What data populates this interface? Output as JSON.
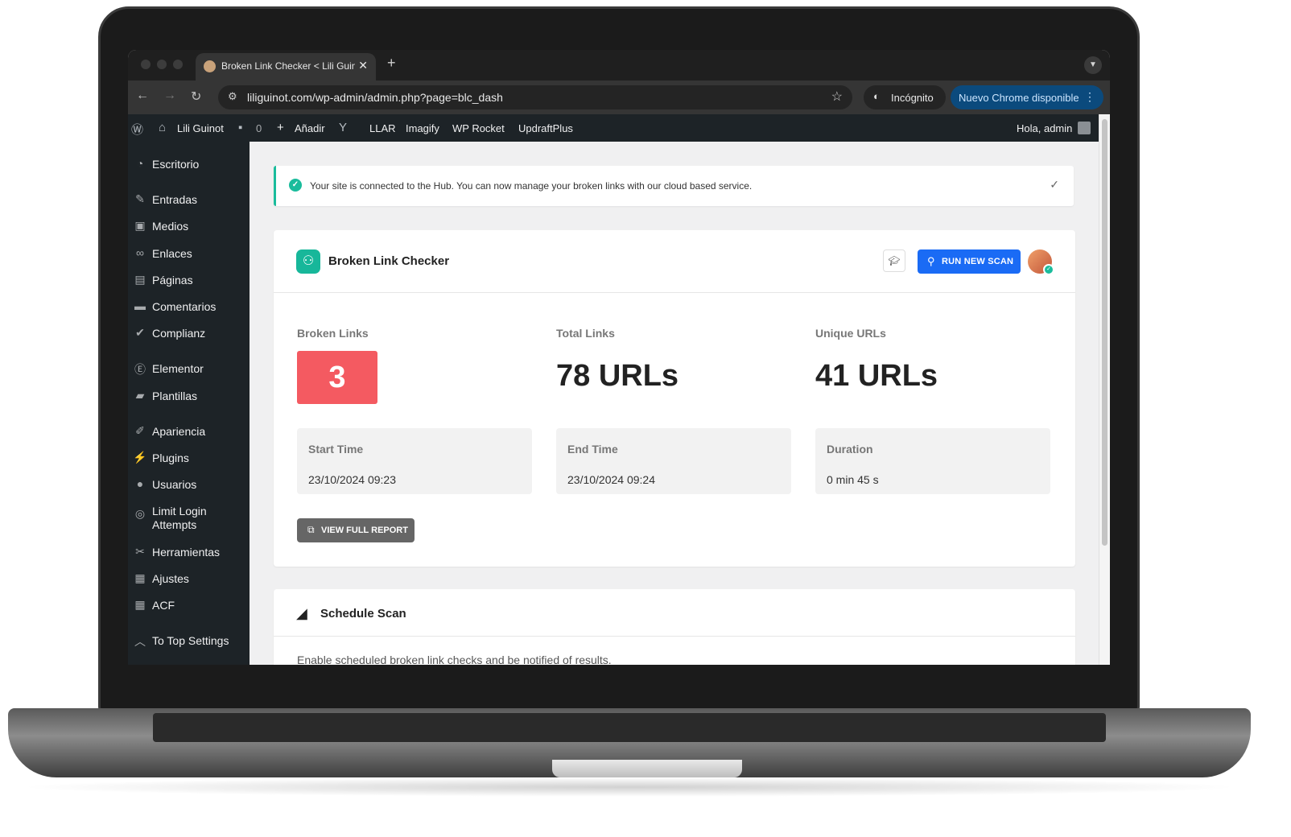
{
  "browser": {
    "tab_title": "Broken Link Checker < Lili Guinot",
    "tab_close_glyph": "✕",
    "new_tab_glyph": "+",
    "url": "liliguinot.com/wp-admin/admin.php?page=blc_dash",
    "incognito_label": "Incógnito",
    "update_label": "Nuevo Chrome disponible"
  },
  "admin_bar": {
    "site_name": "Lili Guinot",
    "comments_count": "0",
    "add_new": "Añadir",
    "items": [
      "LLAR",
      "Imagify",
      "WP Rocket",
      "UpdraftPlus"
    ],
    "greeting": "Hola, admin"
  },
  "sidebar": {
    "items": [
      {
        "label": "Escritorio",
        "icon": "dashboard-icon"
      },
      {
        "label": "Entradas",
        "icon": "pin-icon"
      },
      {
        "label": "Medios",
        "icon": "media-icon"
      },
      {
        "label": "Enlaces",
        "icon": "link-icon"
      },
      {
        "label": "Páginas",
        "icon": "pages-icon"
      },
      {
        "label": "Comentarios",
        "icon": "comment-icon"
      },
      {
        "label": "Complianz",
        "icon": "check-icon"
      },
      {
        "label": "Elementor",
        "icon": "elementor-icon"
      },
      {
        "label": "Plantillas",
        "icon": "folder-icon"
      },
      {
        "label": "Apariencia",
        "icon": "brush-icon"
      },
      {
        "label": "Plugins",
        "icon": "plug-icon"
      },
      {
        "label": "Usuarios",
        "icon": "user-icon"
      },
      {
        "label": "Limit Login Attempts",
        "icon": "fingerprint-icon"
      },
      {
        "label": "Herramientas",
        "icon": "wrench-icon"
      },
      {
        "label": "Ajustes",
        "icon": "sliders-icon"
      },
      {
        "label": "ACF",
        "icon": "table-icon"
      },
      {
        "label": "To Top Settings",
        "icon": "chevron-up-icon"
      }
    ]
  },
  "notice": {
    "text": "Your site is connected to the Hub. You can now manage your broken links with our cloud based service."
  },
  "main_card": {
    "title": "Broken Link Checker",
    "run_scan_label": "RUN NEW SCAN",
    "broken_links_label": "Broken Links",
    "broken_links_value": "3",
    "total_links_label": "Total Links",
    "total_links_value": "78 URLs",
    "unique_urls_label": "Unique URLs",
    "unique_urls_value": "41 URLs",
    "start_time_label": "Start Time",
    "start_time_value": "23/10/2024 09:23",
    "end_time_label": "End Time",
    "end_time_value": "23/10/2024 09:24",
    "duration_label": "Duration",
    "duration_value": "0 min 45 s",
    "view_report_label": "VIEW FULL REPORT"
  },
  "schedule_card": {
    "title": "Schedule Scan",
    "description": "Enable scheduled broken link checks and be notified of results."
  },
  "colors": {
    "broken_badge": "#f45a61",
    "primary_button": "#1a6bf5",
    "wp_admin_dark": "#1d2327",
    "success": "#1abc9c"
  }
}
